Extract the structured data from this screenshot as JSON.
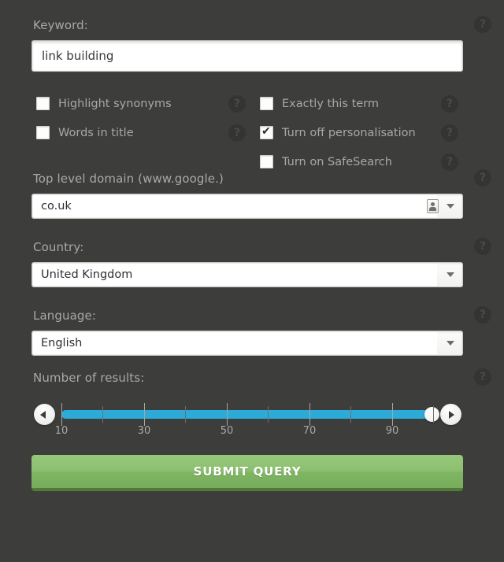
{
  "keyword": {
    "label": "Keyword:",
    "value": "link building",
    "help": "?"
  },
  "options": {
    "left": [
      {
        "label": "Highlight synonyms",
        "checked": false,
        "help": "?"
      },
      {
        "label": "Words in title",
        "checked": false,
        "help": "?"
      }
    ],
    "right": [
      {
        "label": "Exactly this term",
        "checked": false,
        "help": "?"
      },
      {
        "label": "Turn off personalisation",
        "checked": true,
        "help": "?"
      },
      {
        "label": "Turn on SafeSearch",
        "checked": false,
        "help": "?"
      }
    ]
  },
  "tld": {
    "label": "Top level domain (www.google.)",
    "value": "co.uk",
    "help": "?"
  },
  "country": {
    "label": "Country:",
    "value": "United Kingdom",
    "help": "?"
  },
  "language": {
    "label": "Language:",
    "value": "English",
    "help": "?"
  },
  "results": {
    "label": "Number of results:",
    "help": "?",
    "min": 10,
    "max": 100,
    "value": 100,
    "tick_labels": [
      "10",
      "30",
      "50",
      "70",
      "90"
    ],
    "decrement_icon": "triangle-left-icon",
    "increment_icon": "triangle-right-icon"
  },
  "submit": {
    "label": "SUBMIT QUERY"
  },
  "colors": {
    "background": "#3d3d3c",
    "label_text": "#a8a8a6",
    "slider_track": "#2cabd8",
    "submit_green": "#8cc070",
    "submit_green_dark": "#4e7c36"
  }
}
